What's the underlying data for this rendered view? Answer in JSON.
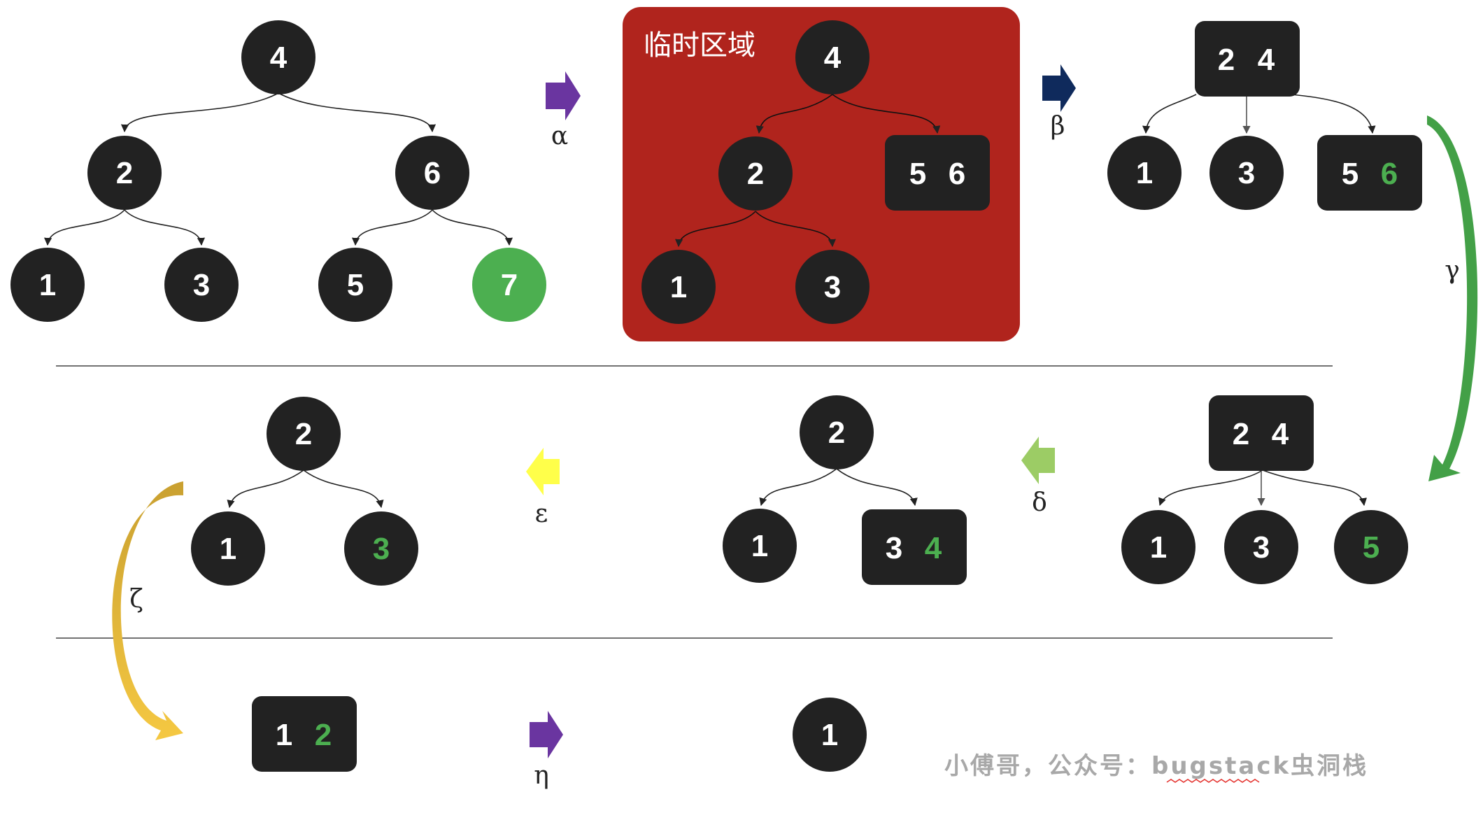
{
  "colors": {
    "node": "#222222",
    "node_text": "#ffffff",
    "highlight": "#4caf50",
    "temp_region": "#b0241d",
    "divider": "#444444",
    "edge": "#222222"
  },
  "temp_region_label": "临时区域",
  "watermark": "小傅哥，公众号：bugstack虫洞栈",
  "transitions": {
    "alpha": "α",
    "beta": "β",
    "gamma": "γ",
    "delta": "δ",
    "epsilon": "ε",
    "zeta": "ζ",
    "eta": "η"
  },
  "stages": {
    "s1": {
      "root": "4",
      "l": "2",
      "r": "6",
      "ll": "1",
      "lr": "3",
      "rl": "5",
      "rr": "7"
    },
    "s2": {
      "root": "4",
      "l": "2",
      "r_a": "5",
      "r_b": "6",
      "ll": "1",
      "lr": "3"
    },
    "s3": {
      "root_a": "2",
      "root_b": "4",
      "c1": "1",
      "c2": "3",
      "c3_a": "5",
      "c3_b": "6"
    },
    "s4": {
      "root_a": "2",
      "root_b": "4",
      "c1": "1",
      "c2": "3",
      "c3": "5"
    },
    "s5": {
      "root": "2",
      "l": "1",
      "r_a": "3",
      "r_b": "4"
    },
    "s6": {
      "root": "2",
      "l": "1",
      "r": "3"
    },
    "s7": {
      "a": "1",
      "b": "2"
    },
    "s8": {
      "root": "1"
    }
  }
}
